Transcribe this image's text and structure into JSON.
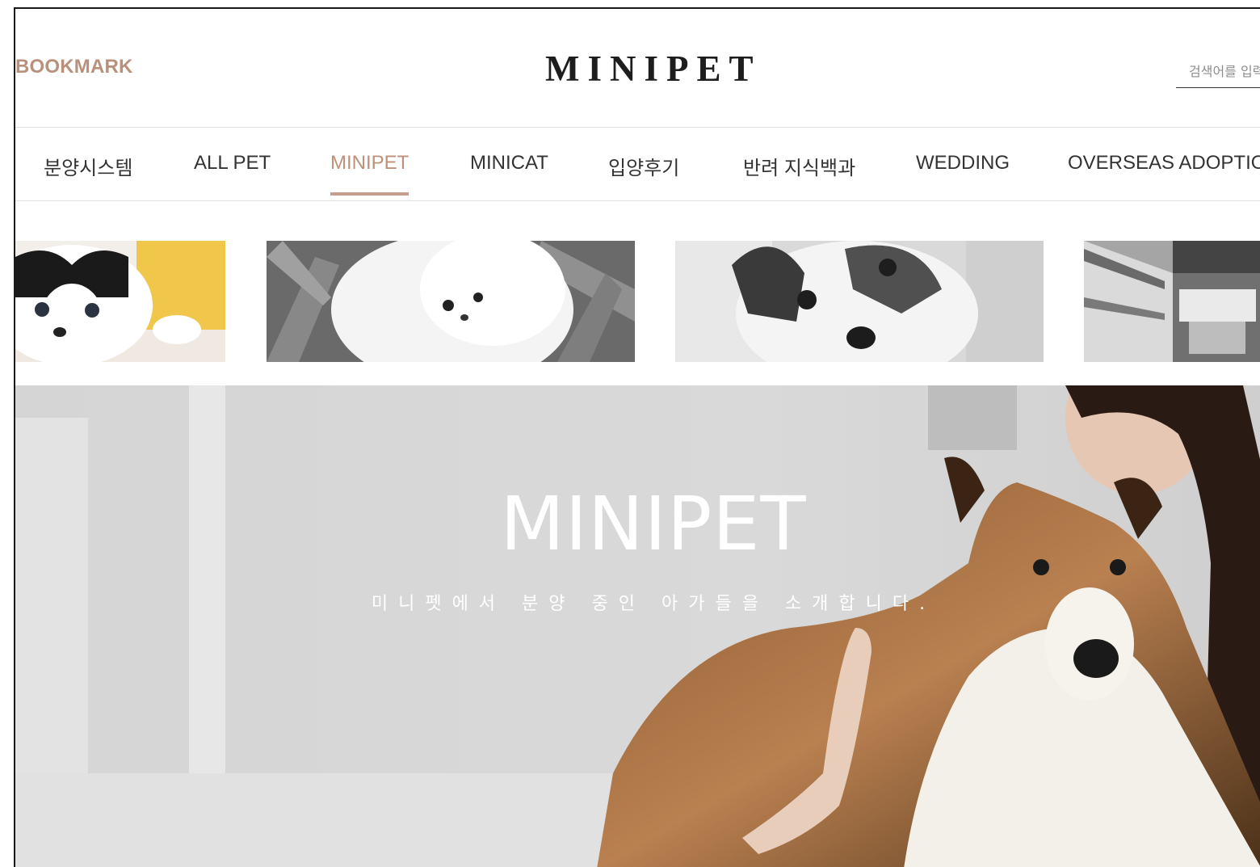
{
  "header": {
    "bookmark_label": "BOOKMARK",
    "logo": "MINIPET",
    "search_placeholder": "검색어를 입력하세요"
  },
  "nav": {
    "items": [
      {
        "label": "분양시스템",
        "active": false
      },
      {
        "label": "ALL PET",
        "active": false
      },
      {
        "label": "MINIPET",
        "active": true
      },
      {
        "label": "MINICAT",
        "active": false
      },
      {
        "label": "입양후기",
        "active": false
      },
      {
        "label": "반려 지식백과",
        "active": false
      },
      {
        "label": "WEDDING",
        "active": false
      },
      {
        "label": "OVERSEAS ADOPTION",
        "active": false
      }
    ]
  },
  "hero": {
    "title": "MINIPET",
    "subtitle": "미니펫에서 분양 중인 아가들을 소개합니다."
  },
  "colors": {
    "accent": "#bf907a",
    "text": "#333333",
    "border": "#e2e2e2"
  }
}
